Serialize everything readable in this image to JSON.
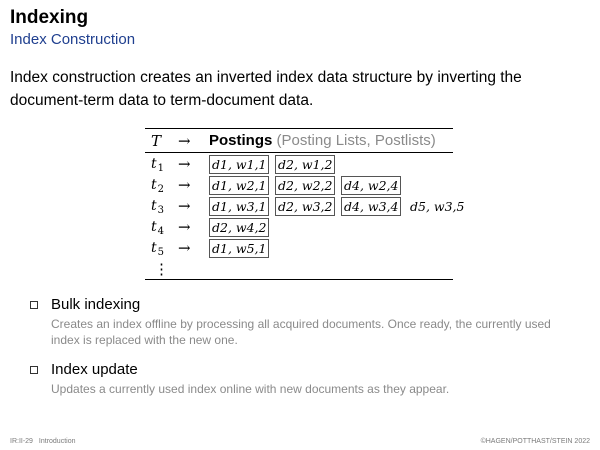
{
  "header": {
    "title": "Indexing",
    "subtitle": "Index Construction"
  },
  "intro_text": "Index construction creates an inverted index data structure by inverting the document-term data to term-document data.",
  "table": {
    "col_term": "T",
    "col_arrow": "→",
    "postings_bold": "Postings",
    "postings_muted": "(Posting Lists, Postlists)",
    "rows": [
      {
        "term": "t",
        "term_sub": "1",
        "arrow": "→",
        "postings": [
          "d1, w1,1",
          "d2, w1,2"
        ]
      },
      {
        "term": "t",
        "term_sub": "2",
        "arrow": "→",
        "postings": [
          "d1, w2,1",
          "d2, w2,2",
          "d4, w2,4"
        ]
      },
      {
        "term": "t",
        "term_sub": "3",
        "arrow": "→",
        "postings": [
          "d1, w3,1",
          "d2, w3,2",
          "d4, w3,4",
          "d5, w3,5"
        ]
      },
      {
        "term": "t",
        "term_sub": "4",
        "arrow": "→",
        "postings": [
          "d2, w4,2"
        ]
      },
      {
        "term": "t",
        "term_sub": "5",
        "arrow": "→",
        "postings": [
          "d1, w5,1"
        ]
      }
    ],
    "ellipsis": "⋮"
  },
  "bullets": [
    {
      "heading": "Bulk indexing",
      "description": "Creates an index offline by processing all acquired documents. Once ready, the currently used index is replaced with the new one."
    },
    {
      "heading": "Index update",
      "description": "Updates a currently used index online with new documents as they appear."
    }
  ],
  "footer": {
    "page": "IR:II-29",
    "section": "Introduction",
    "copyright": "©HAGEN/POTTHAST/STEIN 2022"
  },
  "colors": {
    "subtitle": "#1f3f8f",
    "muted": "#8a8a8a"
  }
}
